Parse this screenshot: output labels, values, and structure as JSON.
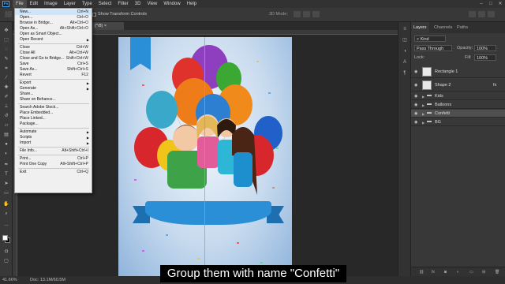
{
  "app": {
    "logo": "Ps"
  },
  "menubar": [
    "File",
    "Edit",
    "Image",
    "Layer",
    "Type",
    "Select",
    "Filter",
    "3D",
    "View",
    "Window",
    "Help"
  ],
  "window_controls": [
    "–",
    "□",
    "✕"
  ],
  "options": {
    "transform_label": "Show Transform Controls",
    "mode_3d": "3D Mode:"
  },
  "doc_tab": {
    "label": "(*/8) ×"
  },
  "file_menu": [
    {
      "label": "New...",
      "shortcut": "Ctrl+N"
    },
    {
      "label": "Open...",
      "shortcut": "Ctrl+O"
    },
    {
      "label": "Browse in Bridge...",
      "shortcut": "Alt+Ctrl+O"
    },
    {
      "label": "Open As...",
      "shortcut": "Alt+Shift+Ctrl+O"
    },
    {
      "label": "Open as Smart Object...",
      "shortcut": ""
    },
    {
      "label": "Open Recent",
      "shortcut": "",
      "submenu": true
    },
    {
      "sep": true
    },
    {
      "label": "Close",
      "shortcut": "Ctrl+W"
    },
    {
      "label": "Close All",
      "shortcut": "Alt+Ctrl+W"
    },
    {
      "label": "Close and Go to Bridge...",
      "shortcut": "Shift+Ctrl+W"
    },
    {
      "label": "Save",
      "shortcut": "Ctrl+S"
    },
    {
      "label": "Save As...",
      "shortcut": "Shift+Ctrl+S"
    },
    {
      "label": "Revert",
      "shortcut": "F12"
    },
    {
      "sep": true
    },
    {
      "label": "Export",
      "shortcut": "",
      "submenu": true
    },
    {
      "label": "Generate",
      "shortcut": "",
      "submenu": true
    },
    {
      "label": "Share...",
      "shortcut": ""
    },
    {
      "label": "Share on Behance...",
      "shortcut": ""
    },
    {
      "sep": true
    },
    {
      "label": "Search Adobe Stock...",
      "shortcut": ""
    },
    {
      "label": "Place Embedded...",
      "shortcut": ""
    },
    {
      "label": "Place Linked...",
      "shortcut": ""
    },
    {
      "label": "Package...",
      "shortcut": ""
    },
    {
      "sep": true
    },
    {
      "label": "Automate",
      "shortcut": "",
      "submenu": true
    },
    {
      "label": "Scripts",
      "shortcut": "",
      "submenu": true
    },
    {
      "label": "Import",
      "shortcut": "",
      "submenu": true
    },
    {
      "sep": true
    },
    {
      "label": "File Info...",
      "shortcut": "Alt+Shift+Ctrl+I"
    },
    {
      "sep": true
    },
    {
      "label": "Print...",
      "shortcut": "Ctrl+P"
    },
    {
      "label": "Print One Copy",
      "shortcut": "Alt+Shift+Ctrl+P"
    },
    {
      "sep": true
    },
    {
      "label": "Exit",
      "shortcut": "Ctrl+Q"
    }
  ],
  "layers_panel": {
    "tabs": [
      "Layers",
      "Channels",
      "Paths"
    ],
    "filter": "Kind",
    "blend_mode": "Pass Through",
    "opacity_label": "Opacity:",
    "opacity": "100%",
    "lock_label": "Lock:",
    "fill_label": "Fill:",
    "fill": "100%",
    "layers": [
      {
        "name": "Rectangle 1",
        "kind": "shape",
        "selected": false
      },
      {
        "name": "Shape 2",
        "kind": "shape",
        "selected": false,
        "fx": "fx"
      },
      {
        "name": "Kids",
        "kind": "group",
        "selected": false
      },
      {
        "name": "Balloons",
        "kind": "group",
        "selected": false
      },
      {
        "name": "Confetti",
        "kind": "group",
        "selected": true
      },
      {
        "name": "BG",
        "kind": "group",
        "selected": false
      }
    ]
  },
  "status": {
    "zoom": "41.66%",
    "doc": "Doc: 13.1M/60.5M"
  },
  "caption": "Group them with name \"Confetti\"",
  "colors": {
    "accent": "#31a8ff",
    "menu_bg": "#f0f0f0",
    "selection": "#cfe4f7"
  }
}
